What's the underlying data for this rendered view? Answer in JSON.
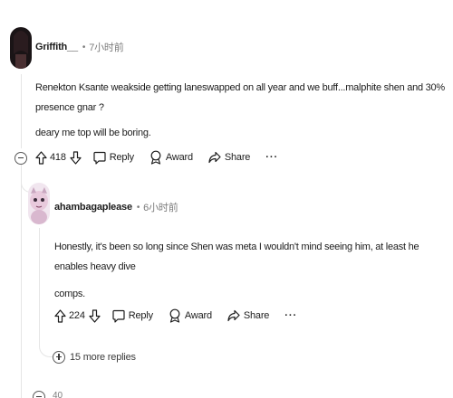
{
  "comments": [
    {
      "username": "Griffith__",
      "time": "7小时前",
      "body_lines": [
        "Renekton Ksante weakside getting laneswapped on all year and we buff...malphite shen and 30% presence gnar ?",
        "deary me top will be boring."
      ],
      "votes": "418",
      "reply_label": "Reply",
      "award_label": "Award",
      "share_label": "Share",
      "more_label": "···"
    },
    {
      "username": "ahambagaplease",
      "time": "6小时前",
      "body_lines": [
        "Honestly, it's been so long since Shen was meta I wouldn't mind seeing him, at least he enables heavy dive",
        "comps."
      ],
      "votes": "224",
      "reply_label": "Reply",
      "award_label": "Award",
      "share_label": "Share",
      "more_label": "···",
      "more_replies": "15 more replies"
    }
  ],
  "next_comment_partial": {
    "votes": "40"
  },
  "icons": {
    "upvote": "upvote-arrow-icon",
    "downvote": "downvote-arrow-icon",
    "reply": "speech-bubble-icon",
    "award": "award-ribbon-icon",
    "share": "share-arrow-icon",
    "collapse": "collapse-thread-icon",
    "expand": "expand-thread-icon"
  },
  "colors": {
    "text": "#1c1c1c",
    "muted": "#7c7c7c",
    "thread_line": "#e5e5e5"
  }
}
